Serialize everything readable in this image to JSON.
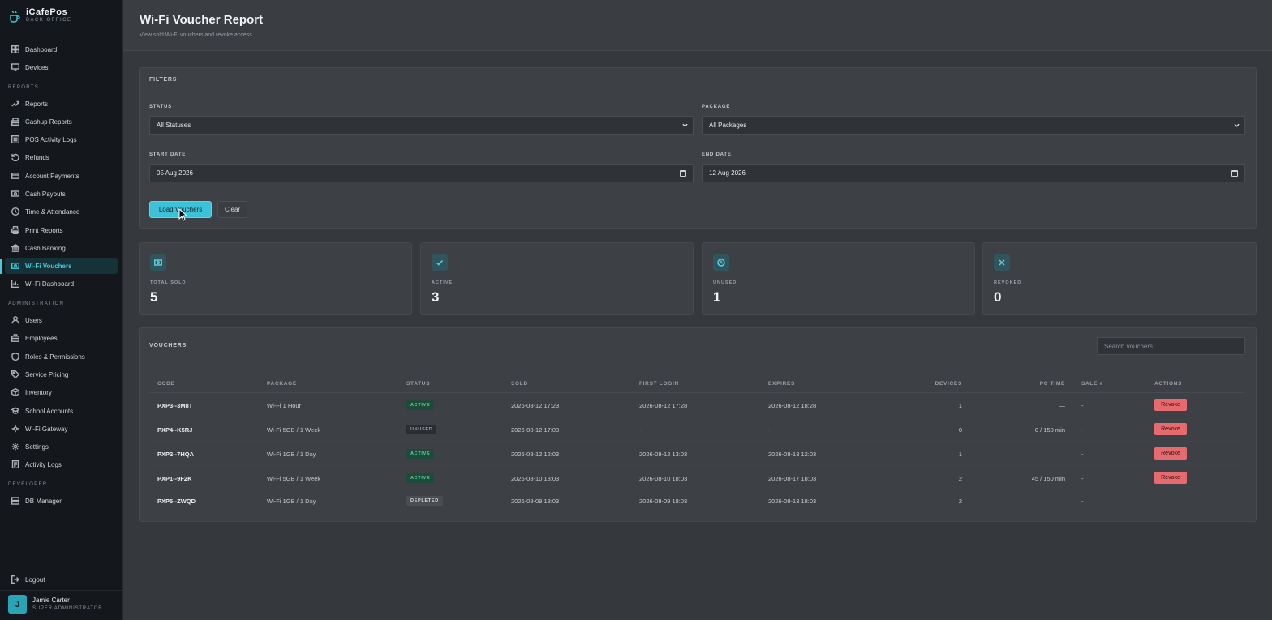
{
  "brand": {
    "name": "iCafePos",
    "subtitle": "BACK OFFICE"
  },
  "nav": {
    "top": [
      {
        "label": "Dashboard",
        "icon": "dashboard-icon"
      },
      {
        "label": "Devices",
        "icon": "monitor-icon"
      }
    ],
    "reports_section": "REPORTS",
    "reports": [
      {
        "label": "Reports",
        "icon": "trend-icon"
      },
      {
        "label": "Cashup Reports",
        "icon": "register-icon"
      },
      {
        "label": "POS Activity Logs",
        "icon": "list-icon"
      },
      {
        "label": "Refunds",
        "icon": "refund-icon"
      },
      {
        "label": "Account Payments",
        "icon": "card-icon"
      },
      {
        "label": "Cash Payouts",
        "icon": "cash-icon"
      },
      {
        "label": "Time & Attendance",
        "icon": "clock-icon"
      },
      {
        "label": "Print Reports",
        "icon": "printer-icon"
      },
      {
        "label": "Cash Banking",
        "icon": "bank-icon"
      },
      {
        "label": "Wi-Fi Vouchers",
        "icon": "ticket-icon",
        "active": true
      },
      {
        "label": "Wi-Fi Dashboard",
        "icon": "bar-chart-icon"
      }
    ],
    "admin_section": "ADMINISTRATION",
    "admin": [
      {
        "label": "Users",
        "icon": "user-icon"
      },
      {
        "label": "Employees",
        "icon": "briefcase-icon"
      },
      {
        "label": "Roles & Permissions",
        "icon": "shield-icon"
      },
      {
        "label": "Service Pricing",
        "icon": "tag-icon"
      },
      {
        "label": "Inventory",
        "icon": "box-icon"
      },
      {
        "label": "School Accounts",
        "icon": "school-icon"
      },
      {
        "label": "Wi-Fi Gateway",
        "icon": "network-icon"
      },
      {
        "label": "Settings",
        "icon": "gear-icon"
      },
      {
        "label": "Activity Logs",
        "icon": "log-icon"
      }
    ],
    "dev_section": "DEVELOPER",
    "dev": [
      {
        "label": "DB Manager",
        "icon": "database-icon"
      }
    ],
    "logout": "Logout"
  },
  "user": {
    "initial": "J",
    "name": "Jamie Carter",
    "role": "SUPER ADMINISTRATOR"
  },
  "page": {
    "title": "Wi-Fi Voucher Report",
    "subtitle": "View sold Wi-Fi vouchers and revoke access"
  },
  "filters": {
    "title": "FILTERS",
    "status_label": "STATUS",
    "status_value": "All Statuses",
    "package_label": "PACKAGE",
    "package_value": "All Packages",
    "start_label": "START DATE",
    "start_value": "05 Aug 2026",
    "end_label": "END DATE",
    "end_value": "12 Aug 2026",
    "load_button": "Load Vouchers",
    "clear_button": "Clear"
  },
  "stats": [
    {
      "label": "TOTAL SOLD",
      "value": "5",
      "icon": "ticket-icon"
    },
    {
      "label": "ACTIVE",
      "value": "3",
      "icon": "check-icon"
    },
    {
      "label": "UNUSED",
      "value": "1",
      "icon": "clock-icon"
    },
    {
      "label": "REVOKED",
      "value": "0",
      "icon": "x-icon"
    }
  ],
  "vouchers": {
    "title": "VOUCHERS",
    "search_placeholder": "Search vouchers...",
    "columns": [
      "CODE",
      "PACKAGE",
      "STATUS",
      "SOLD",
      "FIRST LOGIN",
      "EXPIRES",
      "DEVICES",
      "PC TIME",
      "SALE #",
      "ACTIONS"
    ],
    "revoke_label": "Revoke",
    "rows": [
      {
        "code": "PXP3--3M8T",
        "package": "Wi-Fi 1 Hour",
        "status": "ACTIVE",
        "sold": "2026-08-12 17:23",
        "first_login": "2026-08-12 17:28",
        "expires": "2026-08-12 18:28",
        "devices": "1",
        "pc_time": "—",
        "sale": "-",
        "revocable": true
      },
      {
        "code": "PXP4--K5RJ",
        "package": "Wi-Fi 5GB / 1 Week",
        "status": "UNUSED",
        "sold": "2026-08-12 17:03",
        "first_login": "-",
        "expires": "-",
        "devices": "0",
        "pc_time": "0 / 150 min",
        "sale": "-",
        "revocable": true
      },
      {
        "code": "PXP2--7HQA",
        "package": "Wi-Fi 1GB / 1 Day",
        "status": "ACTIVE",
        "sold": "2026-08-12 12:03",
        "first_login": "2026-08-12 13:03",
        "expires": "2026-08-13 12:03",
        "devices": "1",
        "pc_time": "—",
        "sale": "-",
        "revocable": true
      },
      {
        "code": "PXP1--9F2K",
        "package": "Wi-Fi 5GB / 1 Week",
        "status": "ACTIVE",
        "sold": "2026-08-10 18:03",
        "first_login": "2026-08-10 18:03",
        "expires": "2026-08-17 18:03",
        "devices": "2",
        "pc_time": "45 / 150 min",
        "sale": "-",
        "revocable": true
      },
      {
        "code": "PXP5--ZWQD",
        "package": "Wi-Fi 1GB / 1 Day",
        "status": "DEPLETED",
        "sold": "2026-08-09 18:03",
        "first_login": "2026-08-09 18:03",
        "expires": "2026-08-13 18:03",
        "devices": "2",
        "pc_time": "—",
        "sale": "-",
        "revocable": false
      }
    ]
  },
  "colors": {
    "accent": "#3dc1d6",
    "danger": "#e76a6e",
    "active_badge": "#56d39c"
  }
}
